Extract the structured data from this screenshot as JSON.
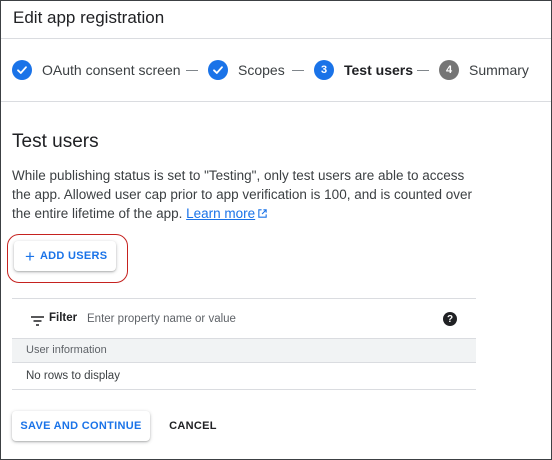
{
  "header": {
    "title": "Edit app registration"
  },
  "stepper": {
    "steps": [
      {
        "label": "OAuth consent screen",
        "state": "done",
        "icon": "check-icon"
      },
      {
        "label": "Scopes",
        "state": "done",
        "icon": "check-icon"
      },
      {
        "label": "Test users",
        "state": "current",
        "number": "3"
      },
      {
        "label": "Summary",
        "state": "pending",
        "number": "4"
      }
    ]
  },
  "main": {
    "title": "Test users",
    "description": "While publishing status is set to \"Testing\", only test users are able to access the app. Allowed user cap prior to app verification is 100, and is counted over the entire lifetime of the app.",
    "learn_more": "Learn more",
    "add_users_label": "ADD USERS"
  },
  "table": {
    "filter_label": "Filter",
    "filter_placeholder": "Enter property name or value",
    "column_header": "User information",
    "empty_text": "No rows to display"
  },
  "footer": {
    "save_label": "SAVE AND CONTINUE",
    "cancel_label": "CANCEL"
  },
  "colors": {
    "accent": "#1a73e8",
    "highlight": "#c5221f",
    "pending_step": "#757575"
  }
}
